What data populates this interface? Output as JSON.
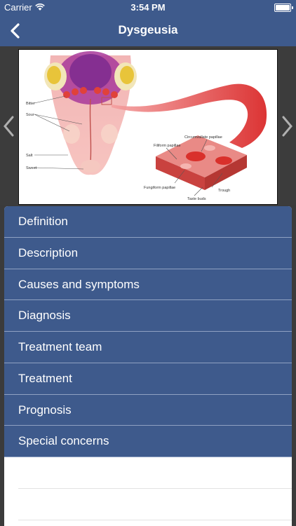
{
  "status": {
    "carrier": "Carrier",
    "time": "3:54 PM"
  },
  "nav": {
    "title": "Dysgeusia"
  },
  "figure": {
    "labels": {
      "bitter": "Bitter",
      "sour": "Sour",
      "salt": "Salt",
      "sweet": "Sweet",
      "circumvallate": "Circumvallate papillae",
      "filiform": "Filiform papillae",
      "fungiform": "Fungiform papillae",
      "trough": "Trough",
      "taste_buds": "Taste buds"
    }
  },
  "menu": {
    "items": [
      "Definition",
      "Description",
      "Causes and symptoms",
      "Diagnosis",
      "Treatment team",
      "Treatment",
      "Prognosis",
      "Special concerns"
    ]
  }
}
